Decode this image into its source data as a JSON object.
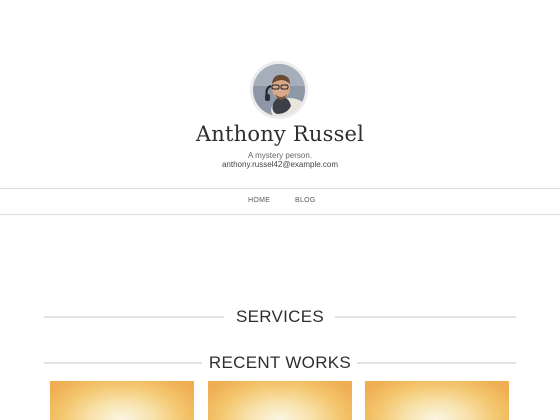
{
  "profile": {
    "name": "Anthony Russel",
    "tagline": "A mystery person.",
    "email": "anthony.russel42@example.com",
    "avatar_icon": "user-avatar-photo"
  },
  "nav": {
    "items": [
      {
        "label": "HOME"
      },
      {
        "label": "BLOG"
      }
    ]
  },
  "sections": {
    "services": {
      "title": "SERVICES"
    },
    "recent_works": {
      "title": "RECENT WORKS"
    }
  },
  "colors": {
    "rule": "#e2e2e2",
    "thumb_orange": "#efae52",
    "thumb_light": "#fbf5e3"
  }
}
